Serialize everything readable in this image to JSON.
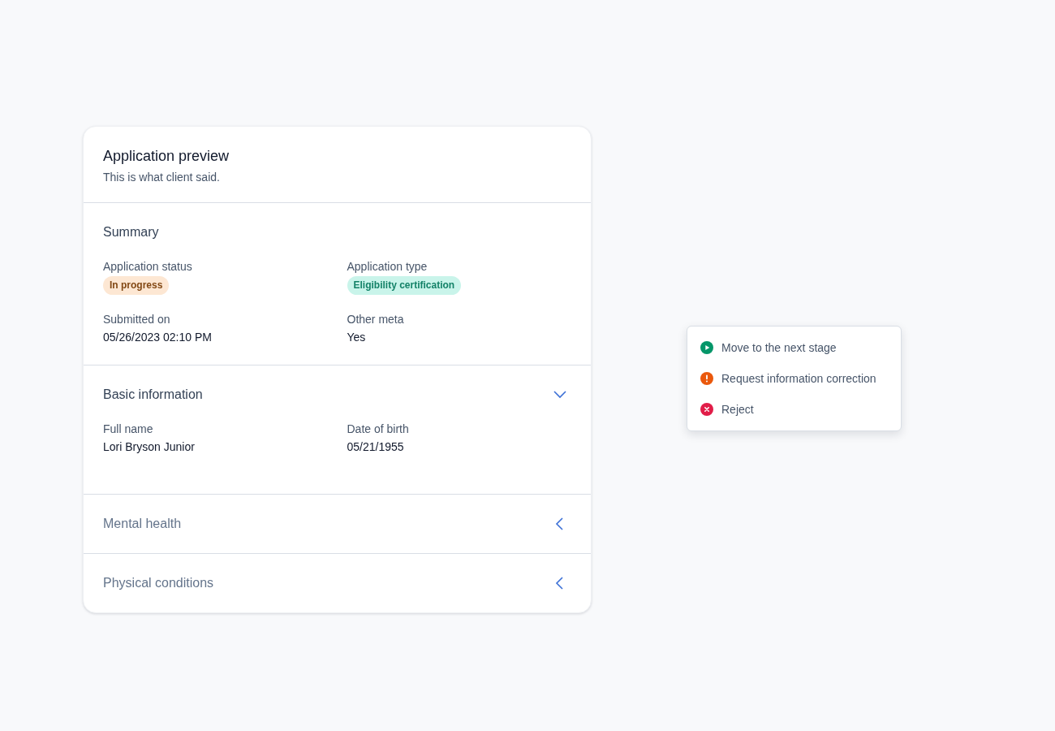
{
  "card": {
    "title": "Application preview",
    "subtitle": "This is what client said."
  },
  "sections": [
    {
      "title": "Summary",
      "kind": "static",
      "fields": [
        {
          "label": "Application status",
          "kind": "badge",
          "color": "#fde7d3",
          "value": "In progress"
        },
        {
          "label": "Application type",
          "kind": "badge",
          "color": "#c9f4ea",
          "value": "Eligibility certification"
        },
        {
          "label": "Submitted on",
          "kind": "text",
          "value": "05/26/2023 02:10 PM"
        },
        {
          "label": "Other meta",
          "kind": "text",
          "value": "Yes"
        }
      ]
    },
    {
      "title": "Basic information",
      "kind": "collapsible",
      "expanded": true,
      "fields": [
        {
          "label": "Full name",
          "kind": "text",
          "value": "Lori Bryson Junior"
        },
        {
          "label": "Date of birth",
          "kind": "text",
          "value": "05/21/1955"
        }
      ]
    },
    {
      "title": "Mental health",
      "kind": "collapsible",
      "expanded": false
    },
    {
      "title": "Physical conditions",
      "kind": "collapsible",
      "expanded": false
    }
  ],
  "menu": [
    {
      "kind": "advance",
      "label": "Move to the next stage"
    },
    {
      "kind": "warning",
      "label": "Request information correction"
    },
    {
      "kind": "reject",
      "label": "Reject"
    }
  ]
}
